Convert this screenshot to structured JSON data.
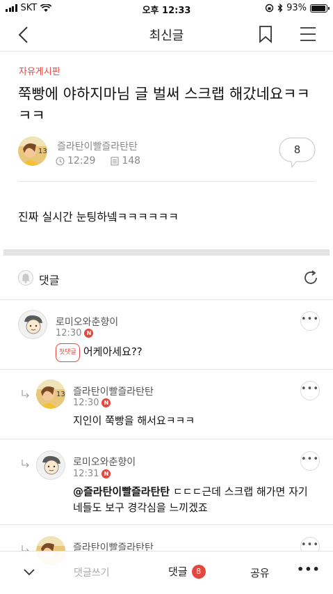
{
  "status_bar": {
    "carrier": "SKT",
    "time": "오후 12:33",
    "battery": "93%",
    "battery_level": 0.93
  },
  "nav": {
    "title": "최신글",
    "back_icon": "chevron-left-icon",
    "bookmark_icon": "bookmark-icon",
    "menu_icon": "hamburger-menu-icon"
  },
  "post": {
    "board": "자유게시판",
    "title": "쭉빵에 야하지마님 글 벌써 스크랩 해갔네요ㅋㅋㅋㅋ",
    "author": "즐라탄이빨즐라탄탄",
    "time": "12:29",
    "views": "148",
    "comment_count": "8",
    "body": "진짜 실시간 눈팅하넼ㅋㅋㅋㅋㅋㅋ"
  },
  "comments_section": {
    "label": "댓글",
    "first_badge": "첫댓글",
    "new_badge": "N",
    "items": [
      {
        "author": "로미오와춘향이",
        "time": "12:30",
        "text": "어케아세요??"
      },
      {
        "author": "즐라탄이빨즐라탄탄",
        "time": "12:30",
        "text": "지인이 쭉빵을 해서요ㅋㅋㅋ"
      },
      {
        "author": "로미오와춘향이",
        "time": "12:31",
        "mention": "@즐라탄이빨즐라탄탄",
        "text": " ㄷㄷㄷ근데 스크랩 해가면 자기네들도 보구 경각심을 느끼겠죠"
      },
      {
        "author": "즐라탄이빨즐라탄탄"
      }
    ]
  },
  "bottom_bar": {
    "write": "댓글쓰기",
    "comments": "댓글",
    "comment_count": "8",
    "share": "공유",
    "more": "•••"
  },
  "colors": {
    "accent": "#e4473d",
    "muted": "#888888",
    "divider": "#e6e6e6"
  }
}
